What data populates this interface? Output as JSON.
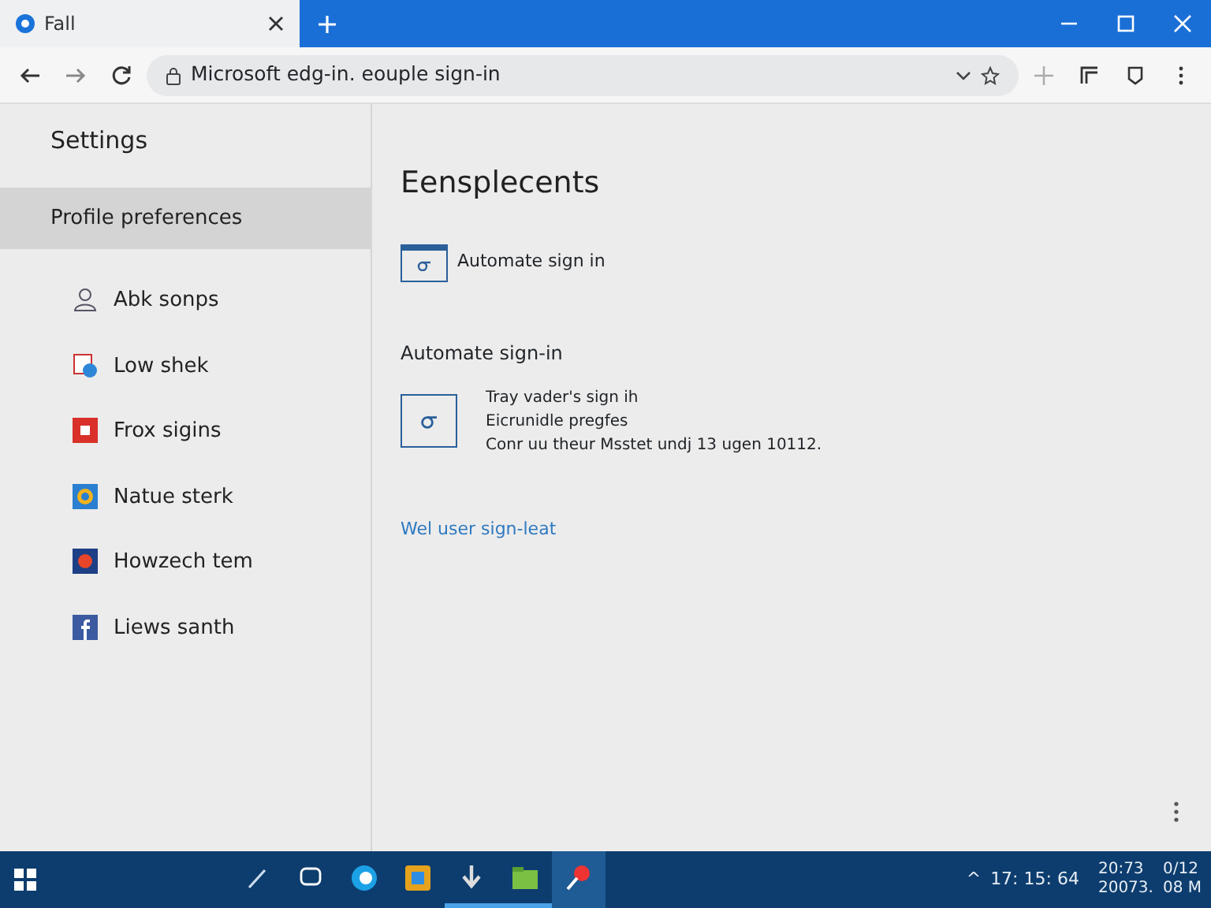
{
  "tabs": [
    {
      "label": "Fall",
      "selected": true
    }
  ],
  "address_bar": {
    "url": "Microsoft edg-in. eouple sign-in"
  },
  "sidebar": {
    "title": "Settings",
    "items": [
      {
        "label": "Profile preferences",
        "selected": true
      },
      {
        "label": "Abk sonps",
        "selected": false
      },
      {
        "label": "Low shek",
        "selected": false
      },
      {
        "label": "Frox sigins",
        "selected": false
      },
      {
        "label": "Natue sterk",
        "selected": false
      },
      {
        "label": "Howzech tem",
        "selected": false
      },
      {
        "label": "Liews santh",
        "selected": false
      }
    ]
  },
  "main": {
    "heading": "Eensplecents",
    "option": {
      "label": "Automate sign in"
    },
    "section_title": "Automate sign-in",
    "card_lines": [
      "Tray vader's sign ih",
      "Eicrunidle pregfes",
      "Conr uu theur Msstet undj 13 ugen 10112."
    ],
    "link": "Wel user sign-leat"
  },
  "taskbar": {
    "apps": [
      {
        "running": false,
        "selected": false
      },
      {
        "running": false,
        "selected": false
      },
      {
        "running": false,
        "selected": false
      },
      {
        "running": false,
        "selected": false
      },
      {
        "running": true,
        "selected": false
      },
      {
        "running": true,
        "selected": false
      },
      {
        "running": false,
        "selected": true
      }
    ],
    "tray": [
      "^",
      "17: 15: 64"
    ],
    "clock": [
      [
        "20:73",
        "20073."
      ],
      [
        "0/12",
        "08 M"
      ]
    ]
  }
}
